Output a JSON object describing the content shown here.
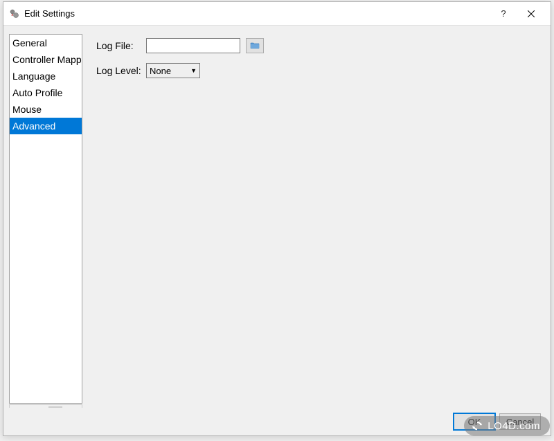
{
  "window": {
    "title": "Edit Settings"
  },
  "sidebar": {
    "items": [
      {
        "label": "General",
        "selected": false
      },
      {
        "label": "Controller Mappings",
        "selected": false
      },
      {
        "label": "Language",
        "selected": false
      },
      {
        "label": "Auto Profile",
        "selected": false
      },
      {
        "label": "Mouse",
        "selected": false
      },
      {
        "label": "Advanced",
        "selected": true
      }
    ]
  },
  "form": {
    "log_file": {
      "label": "Log File:",
      "value": ""
    },
    "log_level": {
      "label": "Log Level:",
      "value": "None"
    }
  },
  "buttons": {
    "ok": "OK",
    "cancel": "Cancel"
  },
  "watermark": {
    "text": "LO4D.com"
  }
}
